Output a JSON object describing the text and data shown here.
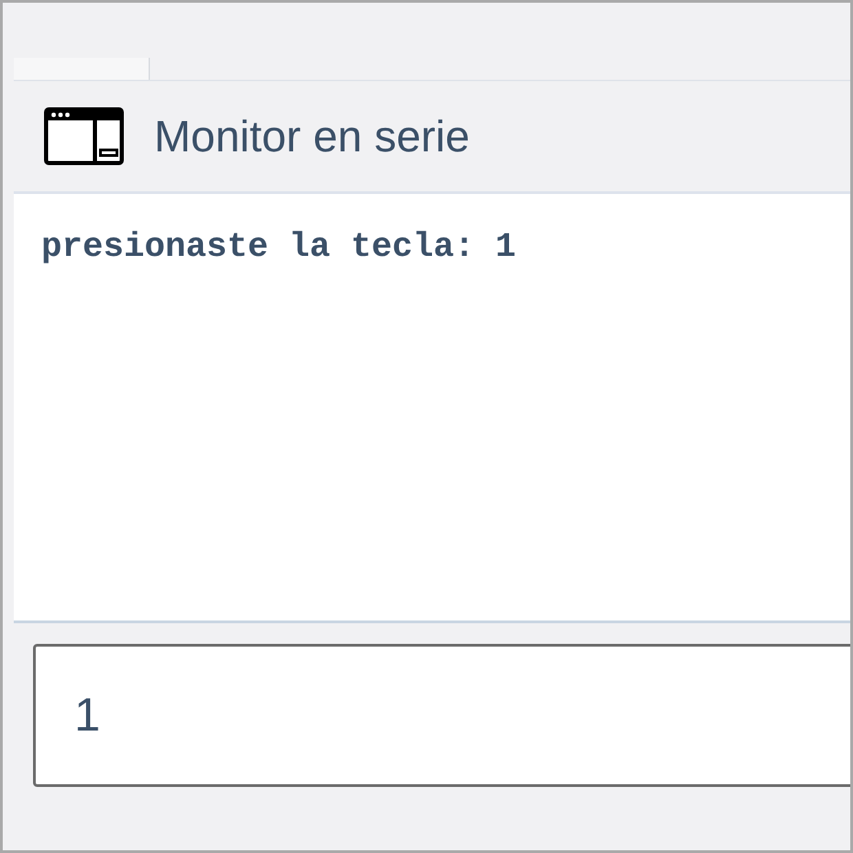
{
  "panel": {
    "title": "Monitor en serie"
  },
  "output": {
    "lines": [
      "presionaste la tecla: 1"
    ]
  },
  "input": {
    "value": "1"
  }
}
